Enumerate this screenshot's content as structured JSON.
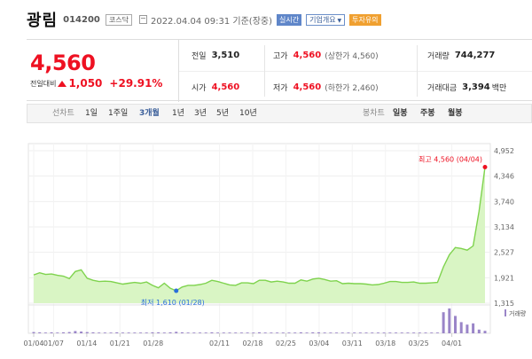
{
  "header": {
    "name": "광림",
    "code": "014200",
    "market": "코스닥",
    "datetime": "2022.04.04 09:31 기준(장중)",
    "btn_realtime": "실시간",
    "btn_info": "기업개요",
    "btn_invest": "투자유의"
  },
  "summary": {
    "price": "4,560",
    "change_label": "전일대비",
    "change_value": "1,050",
    "change_rate": "+29.91%",
    "prev_label": "전일",
    "prev_value": "3,510",
    "open_label": "시가",
    "open_value": "4,560",
    "high_label": "고가",
    "high_value": "4,560",
    "high_sub": "(상한가 4,560)",
    "low_label": "저가",
    "low_value": "4,560",
    "low_sub": "(하한가 2,460)",
    "volume_label": "거래량",
    "volume_value": "744,277",
    "amount_label": "거래대금",
    "amount_value": "3,394",
    "amount_unit": "백만"
  },
  "toolbar": {
    "line_label": "선차트",
    "periods": [
      "1일",
      "1주일",
      "3개월",
      "1년",
      "3년",
      "5년",
      "10년"
    ],
    "active_period": "3개월",
    "candle_label": "봉차트",
    "candles": [
      "일봉",
      "주봉",
      "월봉"
    ]
  },
  "colors": {
    "up": "#e12",
    "line": "#7fd34e",
    "area": "#d9f5c4",
    "accent": "#3b5f9a",
    "volume": "#9a85c8"
  },
  "chart_data": {
    "type": "area",
    "yticks": [
      "4,952",
      "4,346",
      "3,740",
      "3,134",
      "2,527",
      "1,921",
      "1,315"
    ],
    "ylim": [
      1315,
      4952
    ],
    "xticks": [
      "01/04",
      "01/07",
      "01/14",
      "01/21",
      "01/28",
      "02/11",
      "02/18",
      "02/25",
      "03/04",
      "03/11",
      "03/18",
      "03/25",
      "04/01"
    ],
    "max_label": "최고 4,560 (04/04)",
    "min_label": "최저 1,610 (01/28)",
    "volume_legend": "거래량",
    "series": [
      {
        "values": [
          1990,
          2040,
          2000,
          2010,
          1980,
          1960,
          1900,
          2070,
          2110,
          1910,
          1860,
          1830,
          1840,
          1830,
          1800,
          1770,
          1790,
          1810,
          1790,
          1820,
          1740,
          1680,
          1790,
          1670,
          1610,
          1700,
          1740,
          1740,
          1760,
          1790,
          1860,
          1830,
          1790,
          1750,
          1740,
          1800,
          1800,
          1780,
          1860,
          1860,
          1820,
          1840,
          1820,
          1790,
          1790,
          1870,
          1840,
          1890,
          1910,
          1880,
          1840,
          1850,
          1780,
          1790,
          1780,
          1780,
          1770,
          1750,
          1760,
          1790,
          1830,
          1830,
          1810,
          1810,
          1820,
          1790,
          1790,
          1800,
          1810,
          2180,
          2470,
          2640,
          2620,
          2580,
          2680,
          3510,
          4560
        ]
      }
    ],
    "volume": [
      0.05,
      0.04,
      0.03,
      0.04,
      0.03,
      0.04,
      0.05,
      0.09,
      0.07,
      0.05,
      0.04,
      0.03,
      0.03,
      0.03,
      0.04,
      0.03,
      0.03,
      0.03,
      0.03,
      0.03,
      0.04,
      0.04,
      0.03,
      0.04,
      0.06,
      0.04,
      0.03,
      0.03,
      0.03,
      0.03,
      0.04,
      0.03,
      0.03,
      0.03,
      0.03,
      0.03,
      0.03,
      0.03,
      0.04,
      0.03,
      0.03,
      0.03,
      0.03,
      0.03,
      0.03,
      0.04,
      0.03,
      0.04,
      0.04,
      0.03,
      0.03,
      0.03,
      0.03,
      0.03,
      0.03,
      0.03,
      0.03,
      0.03,
      0.03,
      0.03,
      0.03,
      0.03,
      0.03,
      0.03,
      0.03,
      0.03,
      0.03,
      0.03,
      0.03,
      0.85,
      1.0,
      0.7,
      0.45,
      0.35,
      0.4,
      0.15,
      0.1
    ]
  }
}
